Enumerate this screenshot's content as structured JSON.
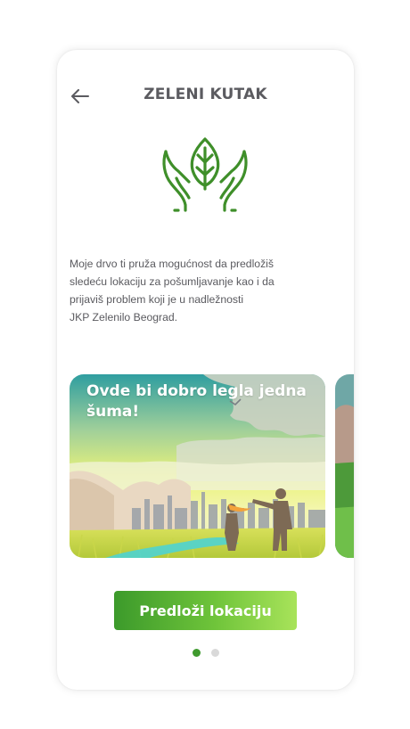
{
  "header": {
    "title": "ZELENI KUTAK",
    "back_icon": "arrow-left-icon"
  },
  "logo": {
    "icon": "hands-leaf-icon",
    "color": "#3f8f2a"
  },
  "description": {
    "lines": [
      "Moje drvo ti pruža mogućnost da predložiš",
      "sledeću lokaciju za pošumljavanje kao i da",
      "prijaviš problem koji je u nadležnosti",
      "JKP Zelenilo Beograd."
    ]
  },
  "carousel": {
    "cards": [
      {
        "title": "Ovde bi dobro legla jedna šuma!"
      },
      {
        "title": ""
      }
    ],
    "active_index": 0,
    "dot_active_color": "#3f9a2e",
    "dot_inactive_color": "#d9d9d9"
  },
  "cta": {
    "label": "Predloži lokaciju"
  }
}
